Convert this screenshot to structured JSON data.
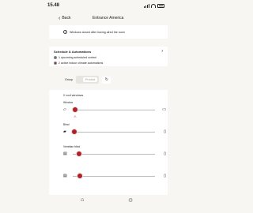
{
  "status": {
    "time": "15.48"
  },
  "header": {
    "back_label": "Back",
    "title": "Entrance America"
  },
  "notice": {
    "text": "Windows closed after having aired the room"
  },
  "schedule": {
    "title": "Schedule & Automations",
    "items": [
      {
        "text": "1 upcoming scheduled control"
      },
      {
        "text": "2 active indoor climate automations"
      }
    ]
  },
  "group": {
    "label": "Group",
    "segments": [
      "",
      "Product"
    ]
  },
  "list": {
    "header": "2 roof windows",
    "items": [
      {
        "label": "Window",
        "position": 0.03
      },
      {
        "label": "Blind",
        "position": 0.02
      },
      {
        "label": "Venetian blind",
        "position": 0.08
      },
      {
        "label": "",
        "position": 0.09
      }
    ]
  },
  "colors": {
    "accent": "#b01f2a",
    "background": "#f7f6f2"
  }
}
